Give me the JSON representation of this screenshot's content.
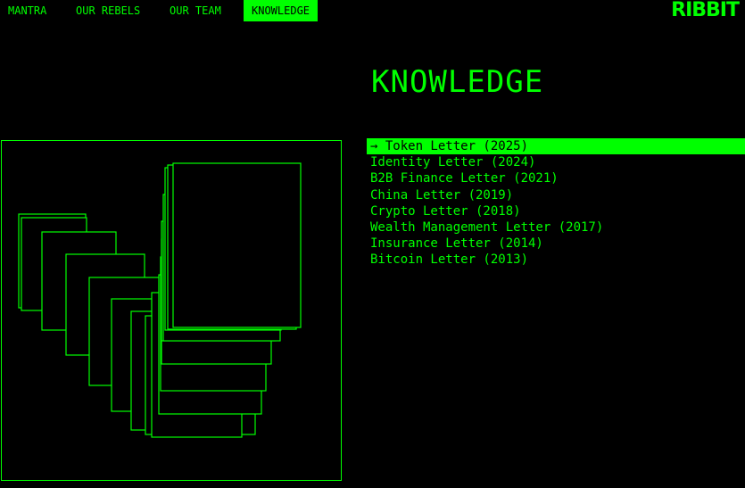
{
  "nav": {
    "items": [
      {
        "label": "MANTRA",
        "active": false
      },
      {
        "label": "OUR REBELS",
        "active": false
      },
      {
        "label": "OUR TEAM",
        "active": false
      },
      {
        "label": "KNOWLEDGE",
        "active": true
      }
    ]
  },
  "logo": {
    "text": "RIBBIT"
  },
  "page": {
    "title": "KNOWLEDGE"
  },
  "letters": [
    {
      "label": "→ Token Letter (2025)",
      "active": true
    },
    {
      "label": "Identity Letter (2024)",
      "active": false
    },
    {
      "label": "B2B Finance Letter (2021)",
      "active": false
    },
    {
      "label": "China Letter (2019)",
      "active": false
    },
    {
      "label": "Crypto Letter (2018)",
      "active": false
    },
    {
      "label": "Wealth Management Letter (2017)",
      "active": false
    },
    {
      "label": "Insurance Letter (2014)",
      "active": false
    },
    {
      "label": "Bitcoin Letter (2013)",
      "active": false
    }
  ],
  "theme": {
    "accent": "#00ff00",
    "background": "#000000"
  }
}
